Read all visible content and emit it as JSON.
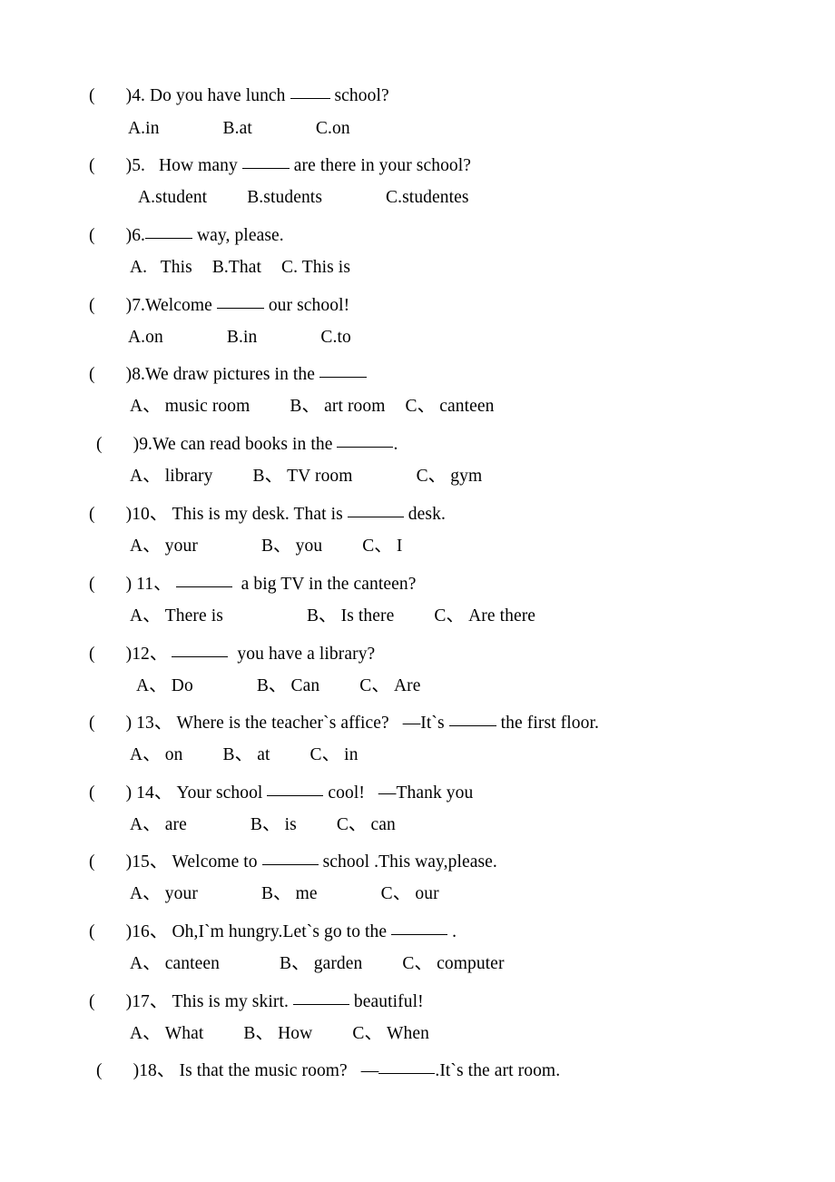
{
  "document": {
    "type": "worksheet",
    "language": "English multiple-choice exercise with Chinese-style option markers",
    "background_color": "#ffffff",
    "text_color": "#000000"
  },
  "questions": [
    {
      "id": "q4",
      "bracket_open": "(",
      "bracket_close": ")",
      "number": "4.",
      "stem_before": " Do you have lunch ",
      "blank": "____",
      "stem_after": " school?",
      "options": [
        {
          "marker": "A.",
          "text": "in"
        },
        {
          "marker": "B.",
          "text": "at"
        },
        {
          "marker": "C.",
          "text": "on"
        }
      ]
    },
    {
      "id": "q5",
      "bracket_open": "(",
      "bracket_close": ")",
      "number": "5.",
      "stem_before": "   How many ",
      "blank": "______",
      "stem_after": " are there in your school?",
      "options": [
        {
          "marker": "A.",
          "text": "student"
        },
        {
          "marker": "B.",
          "text": "students"
        },
        {
          "marker": "C.",
          "text": "studentes"
        }
      ]
    },
    {
      "id": "q6",
      "bracket_open": "(",
      "bracket_close": ")",
      "number": "6.",
      "stem_before": "",
      "blank": "_____",
      "stem_after": " way, please.",
      "options": [
        {
          "marker": "A.",
          "text": "   This"
        },
        {
          "marker": "B.",
          "text": "That"
        },
        {
          "marker": "C.",
          "text": " This is"
        }
      ]
    },
    {
      "id": "q7",
      "bracket_open": "(",
      "bracket_close": ")",
      "number": "7.",
      "stem_before": "Welcome ",
      "blank": "_____",
      "stem_after": " our school!",
      "options": [
        {
          "marker": "A.",
          "text": "on"
        },
        {
          "marker": "B.",
          "text": "in"
        },
        {
          "marker": "C.",
          "text": "to"
        }
      ]
    },
    {
      "id": "q8",
      "bracket_open": "(",
      "bracket_close": ")",
      "number": "8.",
      "stem_before": "We draw pictures in the ",
      "blank": "_____",
      "stem_after": "",
      "options": [
        {
          "marker": "A、",
          "text": "music room"
        },
        {
          "marker": "B、",
          "text": "art room"
        },
        {
          "marker": "C、",
          "text": "canteen"
        }
      ]
    },
    {
      "id": "q9",
      "bracket_open": "(",
      "bracket_close": ")",
      "number": "9.",
      "stem_before": "We can read books in the ",
      "blank": "______",
      "stem_after": ".",
      "options": [
        {
          "marker": "A、",
          "text": "library"
        },
        {
          "marker": "B、",
          "text": "TV room"
        },
        {
          "marker": "C、",
          "text": "gym"
        }
      ]
    },
    {
      "id": "q10",
      "bracket_open": "(",
      "bracket_close": ")",
      "number": "10、",
      "stem_before": " This is my desk. That is ",
      "blank": "______",
      "stem_after": " desk.",
      "options": [
        {
          "marker": "A、",
          "text": "your"
        },
        {
          "marker": "B、",
          "text": "you"
        },
        {
          "marker": "C、",
          "text": "I"
        }
      ]
    },
    {
      "id": "q11",
      "bracket_open": "(",
      "bracket_close": ")",
      "number": " 11、",
      "stem_before": " ",
      "blank": "______",
      "stem_after": "  a big TV in the canteen?",
      "options": [
        {
          "marker": "A、",
          "text": "There is"
        },
        {
          "marker": "B、",
          "text": "Is there"
        },
        {
          "marker": "C、",
          "text": "Are there"
        }
      ]
    },
    {
      "id": "q12",
      "bracket_open": "(",
      "bracket_close": ")",
      "number": "12、",
      "stem_before": " ",
      "blank": "______",
      "stem_after": "  you have a library?",
      "options": [
        {
          "marker": "A、",
          "text": "Do"
        },
        {
          "marker": "B、",
          "text": "Can"
        },
        {
          "marker": "C、",
          "text": "Are"
        }
      ]
    },
    {
      "id": "q13",
      "bracket_open": "(",
      "bracket_close": ")",
      "number": " 13、",
      "stem_before": " Where is the teacher`s affice?   —It`s ",
      "blank": "______",
      "stem_after": " the first floor.",
      "options": [
        {
          "marker": "A、",
          "text": "on"
        },
        {
          "marker": "B、",
          "text": "at"
        },
        {
          "marker": "C、",
          "text": "in"
        }
      ]
    },
    {
      "id": "q14",
      "bracket_open": "(",
      "bracket_close": ")",
      "number": " 14、",
      "stem_before": " Your school ",
      "blank": "______",
      "stem_after": " cool!   —Thank you",
      "options": [
        {
          "marker": "A、",
          "text": "are"
        },
        {
          "marker": "B、",
          "text": "is"
        },
        {
          "marker": "C、",
          "text": "can"
        }
      ]
    },
    {
      "id": "q15",
      "bracket_open": "(",
      "bracket_close": ")",
      "number": "15、",
      "stem_before": " Welcome to ",
      "blank": "______",
      "stem_after": " school .This way,please.",
      "options": [
        {
          "marker": "A、",
          "text": "your"
        },
        {
          "marker": "B、",
          "text": "me"
        },
        {
          "marker": "C、",
          "text": "our"
        }
      ]
    },
    {
      "id": "q16",
      "bracket_open": "(",
      "bracket_close": ")",
      "number": "16、",
      "stem_before": " Oh,I`m hungry.Let`s go to the ",
      "blank": "______",
      "stem_after": " .",
      "options": [
        {
          "marker": "A、",
          "text": "canteen"
        },
        {
          "marker": "B、",
          "text": "garden"
        },
        {
          "marker": "C、",
          "text": "computer"
        }
      ]
    },
    {
      "id": "q17",
      "bracket_open": "(",
      "bracket_close": ")",
      "number": "17、",
      "stem_before": " This is my skirt. ",
      "blank": "______",
      "stem_after": " beautiful!",
      "options": [
        {
          "marker": "A、",
          "text": "What"
        },
        {
          "marker": "B、",
          "text": "How"
        },
        {
          "marker": "C、",
          "text": "When"
        }
      ]
    },
    {
      "id": "q18",
      "bracket_open": "(",
      "bracket_close": ")",
      "number": "18、",
      "stem_before": " Is that the music room?   —",
      "blank": "______",
      "stem_after": ".It`s the art room.",
      "options": []
    }
  ]
}
